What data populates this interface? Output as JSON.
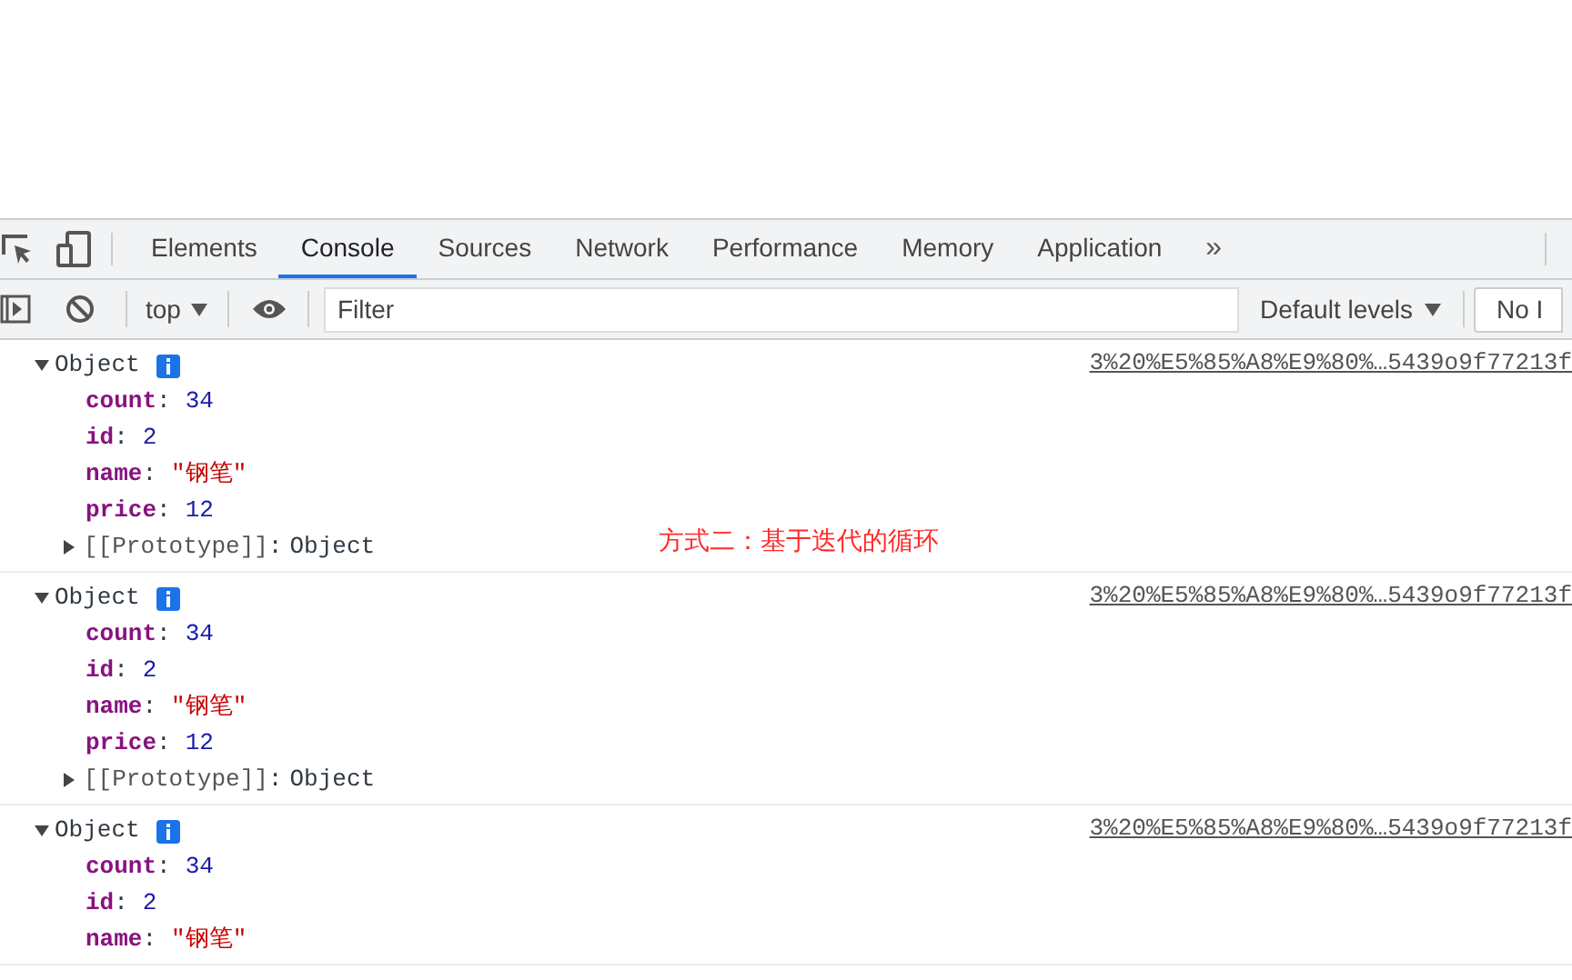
{
  "tabs": [
    {
      "label": "Elements",
      "selected": false
    },
    {
      "label": "Console",
      "selected": true
    },
    {
      "label": "Sources",
      "selected": false
    },
    {
      "label": "Network",
      "selected": false
    },
    {
      "label": "Performance",
      "selected": false
    },
    {
      "label": "Memory",
      "selected": false
    },
    {
      "label": "Application",
      "selected": false
    }
  ],
  "more_tabs": "»",
  "toolbar": {
    "context": "top",
    "filter_placeholder": "Filter",
    "levels": "Default levels",
    "issues": "No I"
  },
  "entries": [
    {
      "label": "Object",
      "expanded": true,
      "source": "3%20%E5%85%A8%E9%80%…5439o9f77213f",
      "properties": [
        {
          "key": "count",
          "value": "34",
          "kind": "number"
        },
        {
          "key": "id",
          "value": "2",
          "kind": "number"
        },
        {
          "key": "name",
          "value": "\"钢笔\"",
          "kind": "string"
        },
        {
          "key": "price",
          "value": "12",
          "kind": "number"
        }
      ],
      "prototype": {
        "label": "[[Prototype]]",
        "value": "Object",
        "expanded": false
      }
    },
    {
      "label": "Object",
      "expanded": true,
      "source": "3%20%E5%85%A8%E9%80%…5439o9f77213f",
      "properties": [
        {
          "key": "count",
          "value": "34",
          "kind": "number"
        },
        {
          "key": "id",
          "value": "2",
          "kind": "number"
        },
        {
          "key": "name",
          "value": "\"钢笔\"",
          "kind": "string"
        },
        {
          "key": "price",
          "value": "12",
          "kind": "number"
        }
      ],
      "prototype": {
        "label": "[[Prototype]]",
        "value": "Object",
        "expanded": false
      }
    },
    {
      "label": "Object",
      "expanded": true,
      "source": "3%20%E5%85%A8%E9%80%…5439o9f77213f",
      "properties": [
        {
          "key": "count",
          "value": "34",
          "kind": "number"
        },
        {
          "key": "id",
          "value": "2",
          "kind": "number"
        },
        {
          "key": "name",
          "value": "\"钢笔\"",
          "kind": "string"
        }
      ]
    }
  ],
  "separator": ":",
  "annotation": "方式二：基于迭代的循环"
}
